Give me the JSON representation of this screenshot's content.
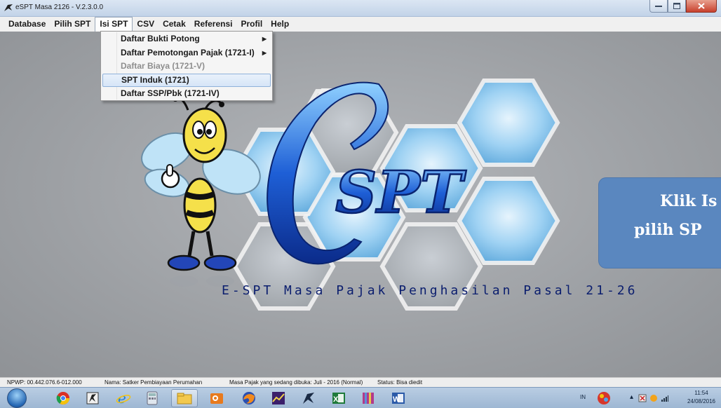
{
  "window": {
    "title": "eSPT Masa 2126 - V.2.3.0.0"
  },
  "menubar": {
    "items": [
      "Database",
      "Pilih SPT",
      "Isi SPT",
      "CSV",
      "Cetak",
      "Referensi",
      "Profil",
      "Help"
    ]
  },
  "dropdown": {
    "items": [
      {
        "label": "Daftar Bukti Potong",
        "submenu": true,
        "enabled": true
      },
      {
        "label": "Daftar Pemotongan Pajak (1721-I)",
        "submenu": true,
        "enabled": true
      },
      {
        "label": "Daftar Biaya  (1721-V)",
        "submenu": false,
        "enabled": false
      },
      {
        "label": "SPT Induk  (1721)",
        "submenu": false,
        "enabled": true,
        "selected": true
      },
      {
        "label": "Daftar SSP/Pbk  (1721-IV)",
        "submenu": false,
        "enabled": true
      }
    ]
  },
  "splash": {
    "logo_text": "SPT",
    "logo_letter": "e",
    "tagline": "E-SPT Masa Pajak Penghasilan Pasal 21-26"
  },
  "callout": {
    "line1": "Klik Is",
    "line2": "pilih SP"
  },
  "statusbar": {
    "npwp": "NPWP: 00.442.076.6-012.000",
    "nama": "Nama: Satker Pembiayaan Perumahan",
    "masa": "Masa Pajak yang sedang dibuka: Juli - 2016 (Normal)",
    "status": "Status: Bisa diedit"
  },
  "taskbar": {
    "lang": "IN",
    "time": "11:54",
    "date": "24/08/2016"
  },
  "colors": {
    "callout": "#5a87bf",
    "menu_selected": "#d6e5f7",
    "tagline": "#0b1e6e"
  }
}
